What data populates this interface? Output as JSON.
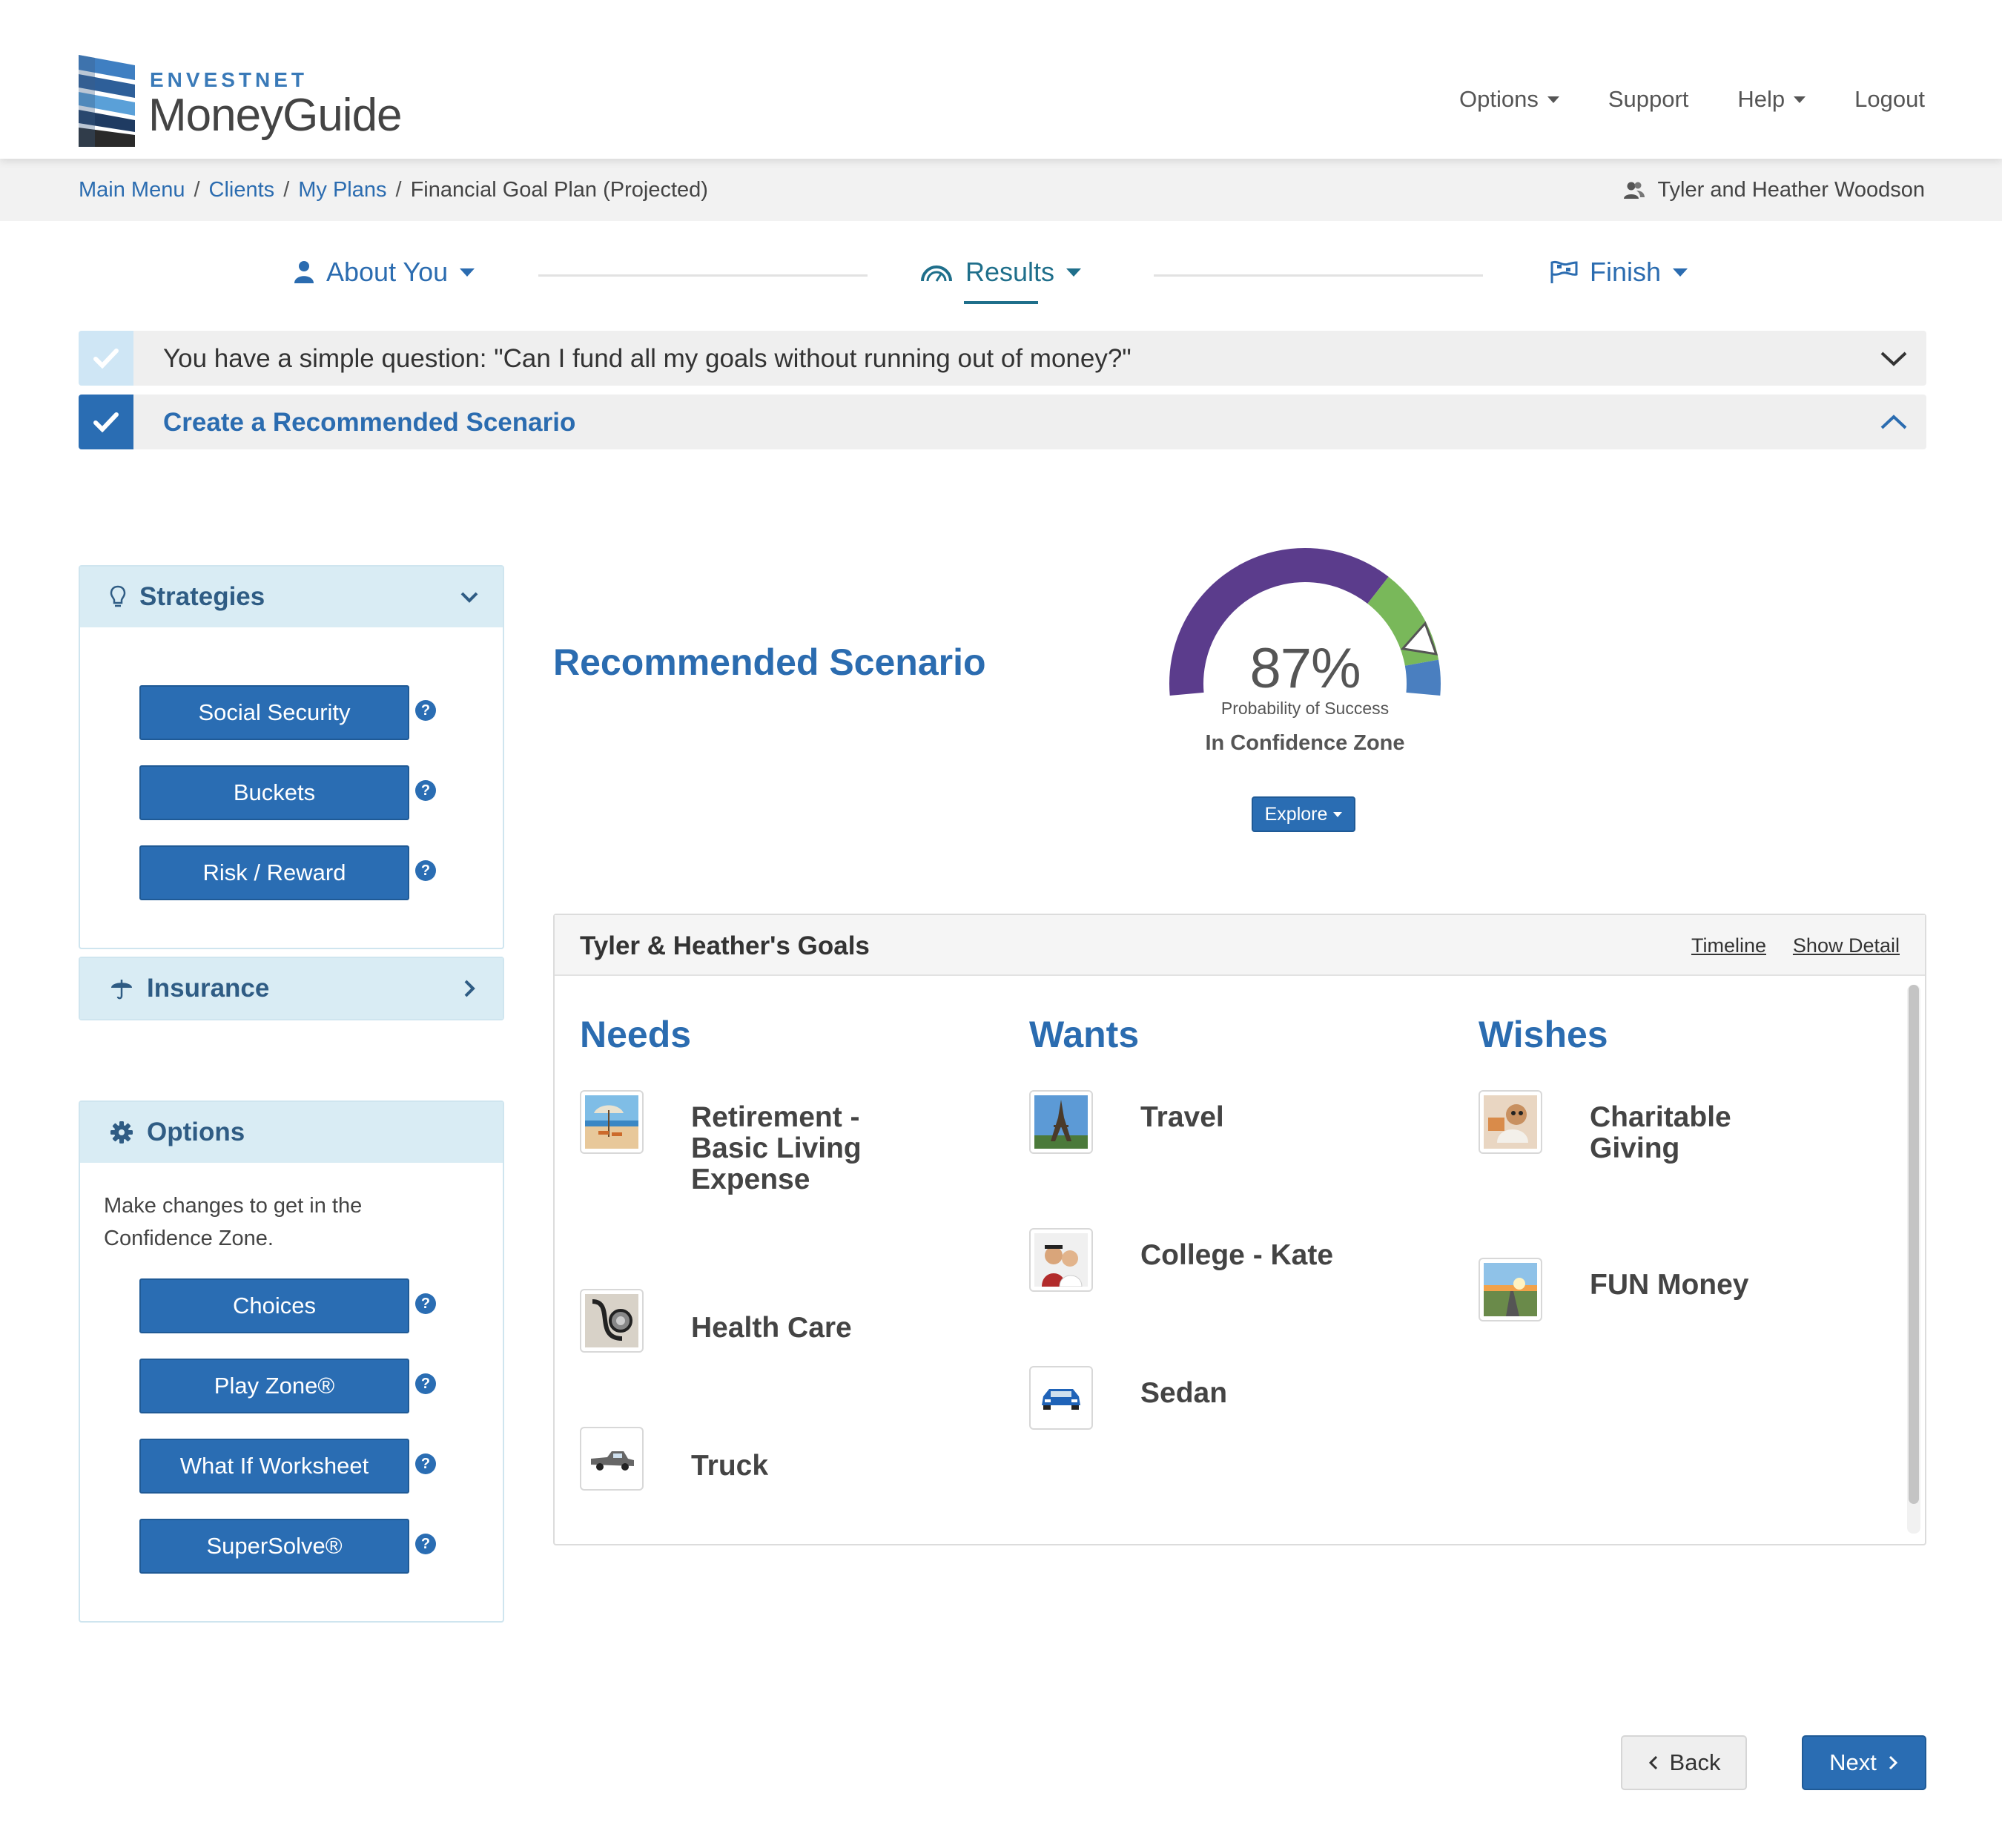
{
  "app": {
    "brand_small": "ENVESTNET",
    "brand_big": "MoneyGuide"
  },
  "topnav": {
    "options": "Options",
    "support": "Support",
    "help": "Help",
    "logout": "Logout"
  },
  "breadcrumb": {
    "items": [
      "Main Menu",
      "Clients",
      "My Plans"
    ],
    "current": "Financial Goal Plan (Projected)"
  },
  "client": {
    "name": "Tyler and Heather Woodson"
  },
  "steps": {
    "about_you": "About You",
    "results": "Results",
    "finish": "Finish",
    "active": "Results"
  },
  "accordions": {
    "question": "You have a simple question: \"Can I fund all my goals without running out of money?\"",
    "recommended": "Create a Recommended Scenario"
  },
  "strategies": {
    "title": "Strategies",
    "buttons": [
      "Social Security",
      "Buckets",
      "Risk / Reward"
    ]
  },
  "insurance": {
    "title": "Insurance"
  },
  "options_panel": {
    "title": "Options",
    "description": "Make changes to get in the Confidence Zone.",
    "buttons": [
      "Choices",
      "Play Zone®",
      "What If Worksheet",
      "SuperSolve®"
    ]
  },
  "scenario": {
    "title": "Recommended Scenario",
    "probability": "87%",
    "probability_value": 87,
    "probability_label": "Probability of Success",
    "zone": "In Confidence Zone",
    "explore": "Explore"
  },
  "goals": {
    "title": "Tyler & Heather's Goals",
    "timeline_link": "Timeline",
    "detail_link": "Show Detail",
    "needs": {
      "title": "Needs",
      "items": [
        "Retirement - Basic Living Expense",
        "Health Care",
        "Truck"
      ]
    },
    "wants": {
      "title": "Wants",
      "items": [
        "Travel",
        "College - Kate",
        "Sedan"
      ]
    },
    "wishes": {
      "title": "Wishes",
      "items": [
        "Charitable Giving",
        "FUN Money"
      ]
    }
  },
  "footer": {
    "back": "Back",
    "next": "Next"
  },
  "colors": {
    "primary": "#2a6db3",
    "gauge_purple": "#5b3c8c",
    "gauge_green": "#79b85a",
    "gauge_blue": "#4a7fc0"
  },
  "icons": {
    "question_check": "check-icon",
    "recommended_check": "check-icon",
    "strategies": "lightbulb-icon",
    "insurance": "umbrella-icon",
    "options": "gear-icon",
    "client": "users-icon",
    "about_you": "user-icon",
    "results": "gauge-icon",
    "finish": "flag-icon"
  }
}
